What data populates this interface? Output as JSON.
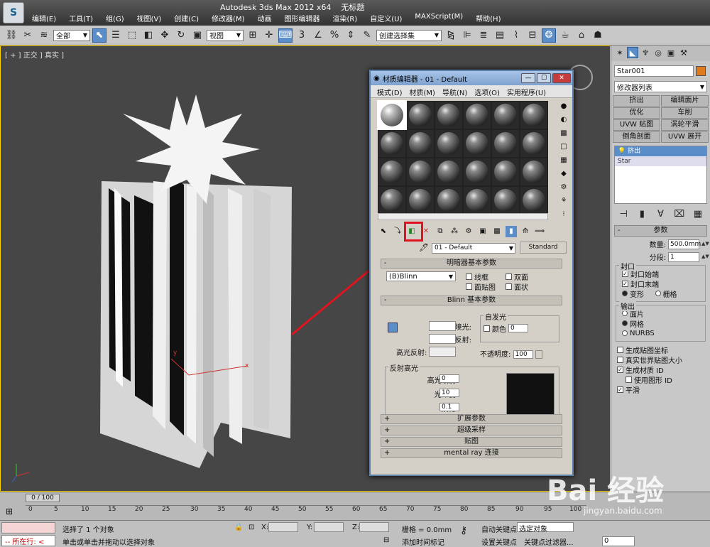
{
  "app": {
    "title": "Autodesk 3ds Max 2012 x64",
    "file": "无标题",
    "menu": [
      "编辑(E)",
      "工具(T)",
      "组(G)",
      "视图(V)",
      "创建(C)",
      "修改器(M)",
      "动画",
      "图形编辑器",
      "渲染(R)",
      "自定义(U)",
      "MAXScript(M)",
      "帮助(H)"
    ]
  },
  "toolbar": {
    "filter": "全部",
    "coord": "视图",
    "selection_set": "创建选择集"
  },
  "viewport": {
    "label": "[ + ] 正交 ] 真实 ]"
  },
  "command_panel": {
    "object_name": "Star001",
    "modifier_list": "修改器列表",
    "mod_buttons": [
      "挤出",
      "编辑面片",
      "优化",
      "车削",
      "UVW 贴图",
      "涡轮平滑",
      "倒角剖面",
      "UVW 展开"
    ],
    "stack": [
      "挤出",
      "Star"
    ],
    "params_title": "参数",
    "amount_label": "数量:",
    "amount": "500.0mm",
    "segments_label": "分段:",
    "segments": "1",
    "cap_group": "封口",
    "cap_start": "封口始端",
    "cap_end": "封口末端",
    "morph": "变形",
    "grid": "栅格",
    "output_group": "输出",
    "out_patch": "面片",
    "out_mesh": "网格",
    "out_nurbs": "NURBS",
    "gen_map": "生成贴图坐标",
    "real_world": "真实世界贴图大小",
    "gen_mat": "生成材质 ID",
    "use_shape": "使用图形 ID",
    "smooth": "平滑"
  },
  "material_editor": {
    "title": "材质编辑器 - 01 - Default",
    "menu": [
      "模式(D)",
      "材质(M)",
      "导航(N)",
      "选项(O)",
      "实用程序(U)"
    ],
    "mat_name": "01 - Default",
    "mat_type": "Standard",
    "shader_rollout": "明暗器基本参数",
    "shader": "(B)Blinn",
    "wire": "线框",
    "two_sided": "双面",
    "face_map": "面贴图",
    "faceted": "面状",
    "blinn_rollout": "Blinn 基本参数",
    "self_illum": "自发光",
    "color": "颜色",
    "color_val": "0",
    "ambient": "环境光:",
    "diffuse": "漫反射:",
    "specular": "高光反射:",
    "opacity": "不透明度:",
    "opacity_val": "100",
    "spec_hl": "反射高光",
    "spec_level": "高光级别:",
    "spec_level_val": "0",
    "gloss": "光泽度:",
    "gloss_val": "10",
    "soften": "柔化:",
    "soften_val": "0.1",
    "rollouts": [
      "扩展参数",
      "超级采样",
      "贴图",
      "mental ray 连接"
    ]
  },
  "timeline": {
    "slider": "0 / 100",
    "ticks": [
      "0",
      "5",
      "10",
      "15",
      "20",
      "25",
      "30",
      "35",
      "40",
      "45",
      "50",
      "55",
      "60",
      "65",
      "70",
      "75",
      "80",
      "85",
      "90",
      "95",
      "100"
    ]
  },
  "status": {
    "running": "所在行:",
    "selected": "选择了 1 个对象",
    "hint": "单击或单击并拖动以选择对象",
    "x": "X:",
    "y": "Y:",
    "z": "Z:",
    "grid": "栅格 = 0.0mm",
    "add_time": "添加时间标记",
    "auto_key": "自动关键点",
    "set_key": "设置关键点",
    "selected_obj": "选定对象",
    "key_filter": "关键点过滤器...",
    "frame": "0"
  },
  "watermark": {
    "brand": "Bai 经验",
    "url": "jingyan.baidu.com"
  }
}
